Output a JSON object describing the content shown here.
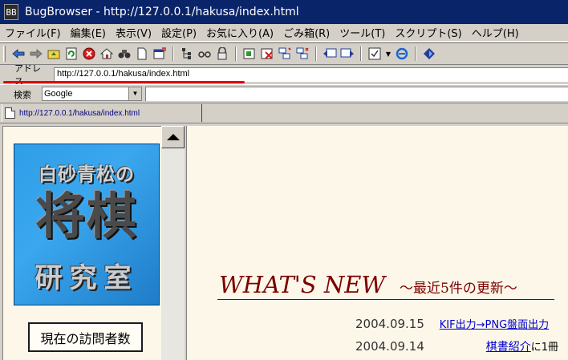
{
  "window": {
    "title": "BugBrowser - http://127.0.0.1/hakusa/index.html",
    "app_icon_text": "BB"
  },
  "menu": [
    "ファイル(F)",
    "編集(E)",
    "表示(V)",
    "設定(P)",
    "お気に入り(A)",
    "ごみ箱(R)",
    "ツール(T)",
    "スクリプト(S)",
    "ヘルプ(H)"
  ],
  "toolbar": {
    "icons": [
      "back-icon",
      "forward-icon",
      "up-folder-icon",
      "refresh-icon",
      "stop-icon",
      "home-icon",
      "find-icon",
      "new-page-icon",
      "new-window-icon",
      "tree-icon",
      "glasses-icon",
      "lock-icon",
      "frame-icon",
      "close-frame-icon",
      "split-icon",
      "tile-icon",
      "prev-window-icon",
      "next-window-icon",
      "check-icon",
      "ie-icon",
      "bookmark-icon"
    ]
  },
  "address": {
    "label": "アドレス",
    "value": "http://127.0.0.1/hakusa/index.html"
  },
  "search": {
    "label": "検索",
    "engine": "Google",
    "query": ""
  },
  "tab": {
    "label": "http://127.0.0.1/hakusa/index.html"
  },
  "page": {
    "logo": {
      "line1": "白砂青松の",
      "line2": "将棋",
      "line3": "研究室"
    },
    "visitor_label": "現在の訪問者数",
    "whats_new": "WHAT'S NEW",
    "whats_new_sub": "～最近5件の更新～",
    "news": [
      {
        "date": "2004.09.15",
        "link": "KIF出力→PNG盤面出力",
        "rest": ""
      },
      {
        "date": "2004.09.14",
        "link": "棋書紹介",
        "rest": "に1冊"
      }
    ]
  },
  "colors": {
    "titlebar": "#0a246a",
    "chrome": "#d4d0c8",
    "page_bg": "#fdf7e9",
    "heading": "#7a0000",
    "link": "#0000cc",
    "logo_blue": "#2f9ee8",
    "highlight_underline": "#e30000"
  }
}
